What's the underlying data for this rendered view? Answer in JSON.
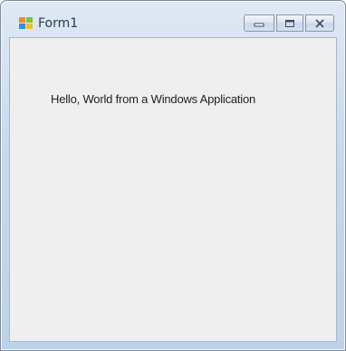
{
  "window": {
    "title": "Form1",
    "icon": "windows-forms-app-icon",
    "caption_buttons": [
      "minimize-icon",
      "maximize-icon",
      "close-icon"
    ]
  },
  "client": {
    "label_text": "Hello, World from a Windows Application"
  }
}
